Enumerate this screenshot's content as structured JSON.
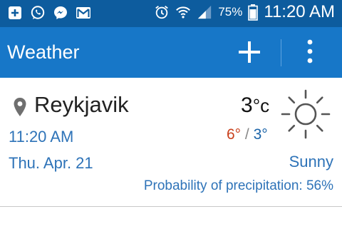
{
  "status_bar": {
    "battery_percent": "75%",
    "time": "11:20 AM",
    "left_icons": [
      "add-icon",
      "whatsapp-icon",
      "messenger-icon",
      "gmail-icon"
    ],
    "right_icons": [
      "alarm-icon",
      "wifi-icon",
      "signal-icon",
      "battery-icon"
    ]
  },
  "app_bar": {
    "title": "Weather",
    "add_icon": "plus-icon",
    "menu_icon": "overflow-menu-icon"
  },
  "weather_card": {
    "city": "Reykjavik",
    "temperature": "3",
    "temperature_unit": "°c",
    "high": "6°",
    "separator": "/",
    "low": "3°",
    "time": "11:20 AM",
    "date": "Thu. Apr. 21",
    "condition": "Sunny",
    "precipitation": "Probability of precipitation: 56%",
    "icons": [
      "location-pin-icon",
      "sun-icon"
    ]
  },
  "colors": {
    "status_bar": "#0d5c9e",
    "app_bar": "#1777c8",
    "accent_text": "#2e73b8",
    "high_temp": "#c9401c",
    "low_temp": "#1a63a8"
  }
}
